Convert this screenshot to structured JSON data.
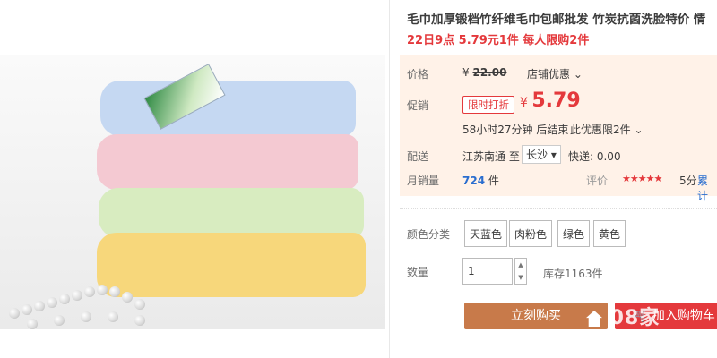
{
  "product": {
    "title": "毛巾加厚锻档竹纤维毛巾包邮批发 竹炭抗菌洗脸特价 情",
    "subtitle": "22日9点 5.79元1件 每人限购2件"
  },
  "price_section": {
    "price_label": "价格",
    "currency": "¥",
    "original_price": "22.00",
    "store_promo": "店铺优惠",
    "promo_label": "促销",
    "promo_badge": "限时打折",
    "current_price": "5.79",
    "countdown": "58小时27分钟 后结束",
    "limit": "此优惠限2件",
    "shipping_label": "配送",
    "ship_from": "江苏南通",
    "ship_to_prefix": "至",
    "ship_to": "长沙",
    "shipping_fee": "快递: 0.00",
    "sales_label": "月销量",
    "sales_count": "724",
    "sales_unit": "件",
    "rating_label": "评价",
    "stars": "★★★★★",
    "rating": "5分",
    "accumulated": "累计"
  },
  "options": {
    "color_label": "颜色分类",
    "colors": [
      "天蓝色",
      "肉粉色",
      "绿色",
      "黄色"
    ],
    "qty_label": "数量",
    "qty_value": "1",
    "stock": "库存1163件"
  },
  "actions": {
    "buy_now": "立刻购买",
    "add_cart": "加入购物车"
  },
  "watermark": "08家"
}
